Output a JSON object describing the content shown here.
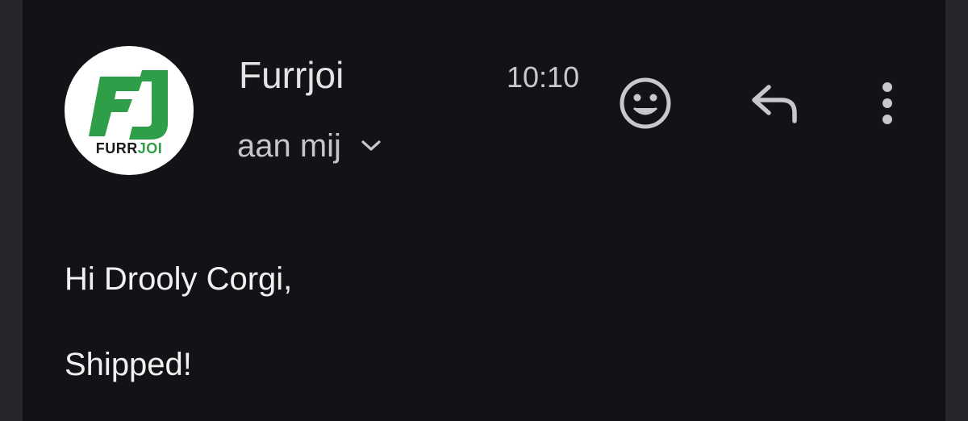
{
  "email": {
    "sender_name": "Furrjoi",
    "sender_logo_text": "FURRJOI",
    "time": "10:10",
    "recipient_label": "aan mij",
    "body_lines": [
      "Hi Drooly Corgi,",
      "Shipped!"
    ]
  },
  "icons": {
    "logo": "furrjoi-logo",
    "recipient_expand": "chevron-down-icon",
    "emoji_reaction": "smiley-icon",
    "reply": "reply-icon",
    "more": "more-vert-icon"
  },
  "colors": {
    "background": "#131317",
    "outer_background": "#27272b",
    "brand_green": "#2e9e48",
    "text_primary": "#e3e3e3",
    "text_secondary": "#c6c6ca",
    "icon": "#c8c8cc"
  }
}
